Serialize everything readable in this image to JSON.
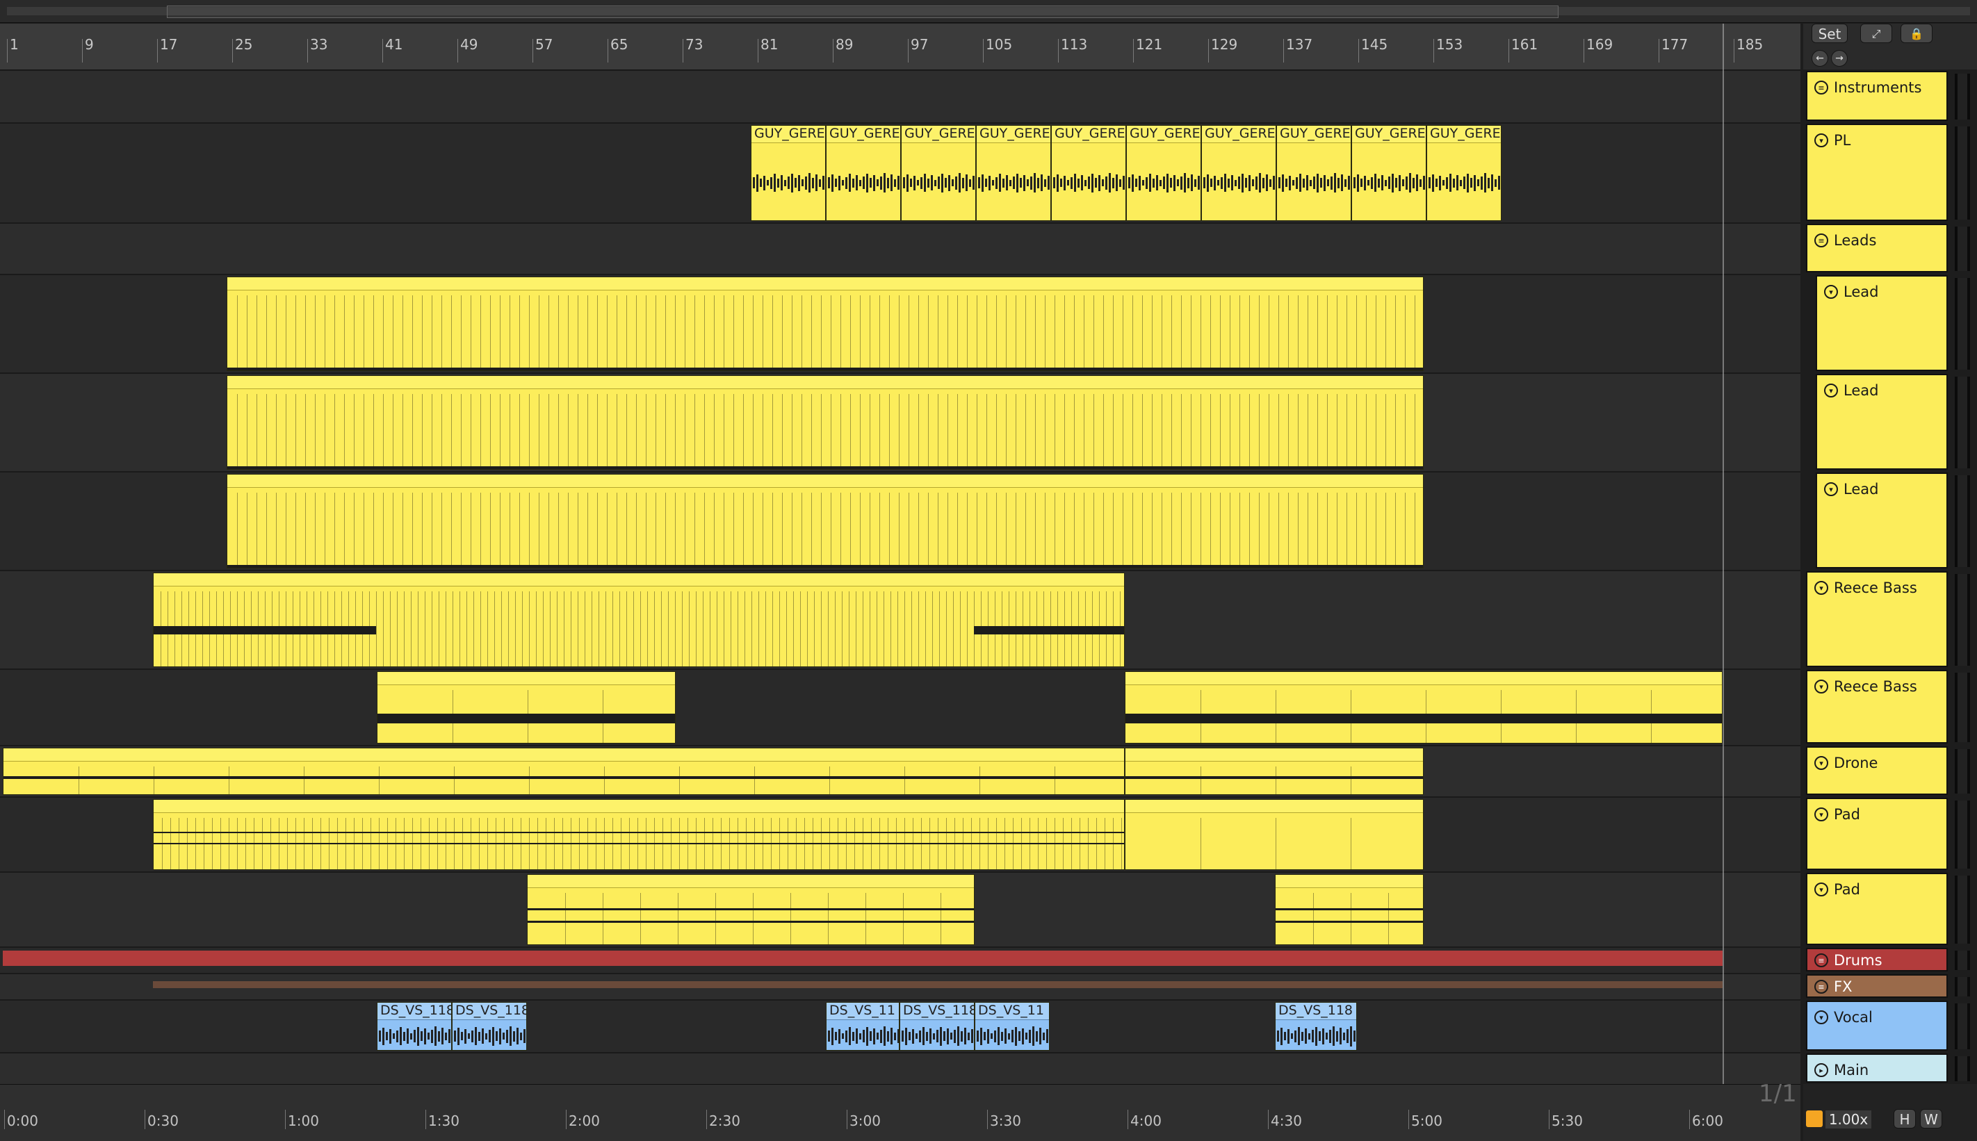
{
  "ruler": {
    "bars": [
      "1",
      "9",
      "17",
      "25",
      "33",
      "41",
      "49",
      "57",
      "65",
      "73",
      "81",
      "89",
      "97",
      "105",
      "113",
      "121",
      "129",
      "137",
      "145",
      "153",
      "161",
      "169",
      "177",
      "185"
    ]
  },
  "time_ruler": {
    "labels": [
      "0:00",
      "0:30",
      "1:00",
      "1:30",
      "2:00",
      "2:30",
      "3:00",
      "3:30",
      "4:00",
      "4:30",
      "5:00",
      "5:30",
      "6:00"
    ]
  },
  "controls": {
    "set_label": "Set",
    "expand_icon": "expand-icon",
    "lock_icon": "lock-icon",
    "back_icon": "back-arrow-icon",
    "forward_icon": "forward-arrow-icon",
    "page_indicator": "1/1",
    "zoom_value": "1.00x",
    "h_label": "H",
    "w_label": "W"
  },
  "clip_names": {
    "pl": "GUY_GERE",
    "vocal_a": "DS_VS_118",
    "vocal_b": "DS_VS_118",
    "vocal_c": "DS_VS_118",
    "vocal_d": "DS_VS_11",
    "vocal_e": "DS_VS_118",
    "vocal_f": "DS_VS_11",
    "vocal_g": "DS_VS_118"
  },
  "tracks": [
    {
      "name": "Instruments",
      "type": "group",
      "color": "#fced5b"
    },
    {
      "name": "PL",
      "type": "track",
      "color": "#fced5b"
    },
    {
      "name": "Leads",
      "type": "group",
      "color": "#fced5b"
    },
    {
      "name": "Lead",
      "type": "track",
      "color": "#fced5b"
    },
    {
      "name": "Lead",
      "type": "track",
      "color": "#fced5b"
    },
    {
      "name": "Lead",
      "type": "track",
      "color": "#fced5b"
    },
    {
      "name": "Reece Bass",
      "type": "track",
      "color": "#fced5b"
    },
    {
      "name": "Reece Bass",
      "type": "track",
      "color": "#fced5b"
    },
    {
      "name": "Drone",
      "type": "track",
      "color": "#fced5b"
    },
    {
      "name": "Pad",
      "type": "track",
      "color": "#fced5b"
    },
    {
      "name": "Pad",
      "type": "track",
      "color": "#fced5b"
    },
    {
      "name": "Drums",
      "type": "group",
      "color": "#b23c3c"
    },
    {
      "name": "FX",
      "type": "group",
      "color": "#9a6a4a"
    },
    {
      "name": "Vocal",
      "type": "track",
      "color": "#8fc2f6"
    },
    {
      "name": "Main",
      "type": "main",
      "color": "#c8e8f0"
    }
  ],
  "colors": {
    "clip_yellow": "#fced5b",
    "clip_blue": "#8fc2f6",
    "drums_red": "#b23c3c",
    "fx_brown": "#9a6a4a"
  }
}
